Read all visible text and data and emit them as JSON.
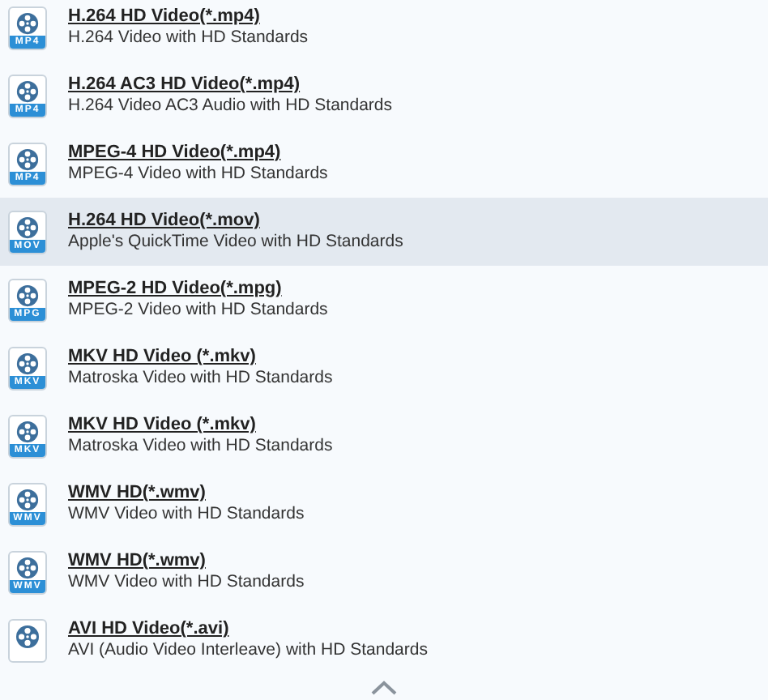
{
  "formats": [
    {
      "title": "H.264 HD Video(*.mp4)",
      "description": "H.264 Video with HD Standards",
      "badge": "MP4",
      "selected": false
    },
    {
      "title": "H.264 AC3 HD Video(*.mp4)",
      "description": "H.264 Video AC3 Audio with HD Standards",
      "badge": "MP4",
      "selected": false
    },
    {
      "title": "MPEG-4 HD Video(*.mp4)",
      "description": "MPEG-4 Video with HD Standards",
      "badge": "MP4",
      "selected": false
    },
    {
      "title": "H.264 HD Video(*.mov)",
      "description": "Apple's QuickTime Video with HD Standards",
      "badge": "MOV",
      "selected": true
    },
    {
      "title": "MPEG-2 HD Video(*.mpg)",
      "description": "MPEG-2 Video with HD Standards",
      "badge": "MPG",
      "selected": false
    },
    {
      "title": "MKV HD Video (*.mkv)",
      "description": "Matroska Video with HD Standards",
      "badge": "MKV",
      "selected": false
    },
    {
      "title": "MKV HD Video (*.mkv)",
      "description": "Matroska Video with HD Standards",
      "badge": "MKV",
      "selected": false
    },
    {
      "title": "WMV HD(*.wmv)",
      "description": "WMV Video with HD Standards",
      "badge": "WMV",
      "selected": false
    },
    {
      "title": "WMV HD(*.wmv)",
      "description": "WMV Video with HD Standards",
      "badge": "WMV",
      "selected": false
    },
    {
      "title": "AVI HD Video(*.avi)",
      "description": "AVI (Audio Video Interleave) with HD Standards"
    }
  ]
}
